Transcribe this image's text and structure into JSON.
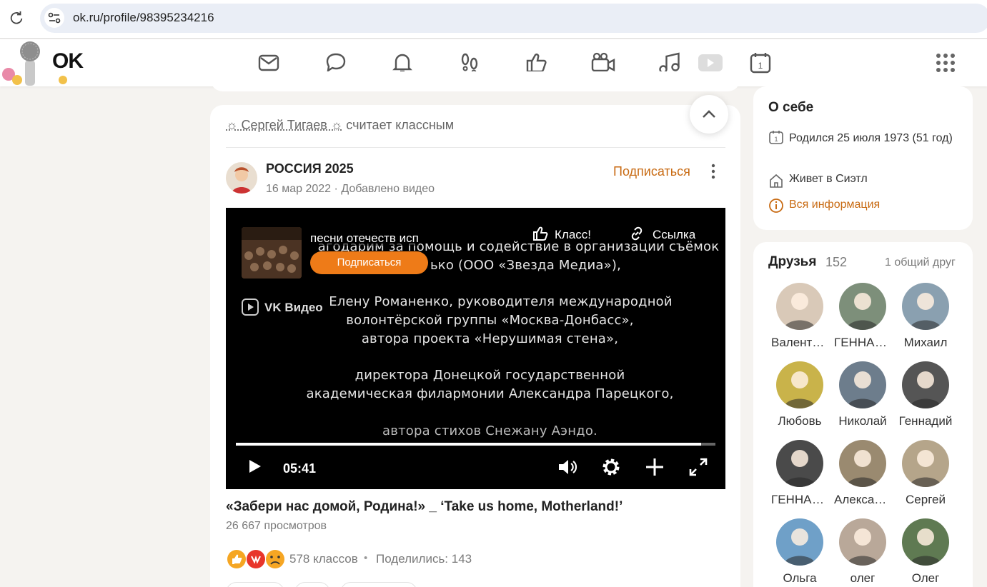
{
  "browser": {
    "url": "ok.ru/profile/98395234216"
  },
  "header": {
    "logo_text": "OK",
    "nav": [
      "messages-icon",
      "discussions-icon",
      "notifications-icon",
      "guests-icon",
      "events-icon",
      "video-icon",
      "music-icon",
      "vk-video-icon",
      "calendar-icon",
      "apps-grid-icon"
    ]
  },
  "feed": {
    "liked": {
      "user": "☼ Сергей Тигаев ☼",
      "action": "считает классным"
    },
    "post": {
      "author": "РОССИЯ 2025",
      "date": "16 мар 2022",
      "sep": "·",
      "action": "Добавлено видео",
      "subscribe": "Подписаться",
      "video": {
        "channel_title": "песни отечеств исп",
        "subscribe": "Подписаться",
        "klass": "Класс!",
        "link": "Ссылка",
        "brand": "VK Видео",
        "time": "05:41",
        "progress": 0.97,
        "credits": [
          "агодарим за помощь и содействие в организации съёмок",
          "ько (ООО «Звезда Медиа»),",
          "Елену Романенко, руководителя международной",
          "волонтёрской группы «Москва-Донбасс»,",
          "автора проекта «Нерушимая стена»,",
          "директора Донецкой государственной",
          "академическая филармонии Александра Парецкого,",
          "автора стихов Снежану Аэндо."
        ]
      },
      "title": "«Забери нас домой, Родина!» _ ‘Take us home, Motherland!’",
      "views": "26 667 просмотров",
      "klass_count": "578 классов",
      "dot": "•",
      "shares": "Поделились: 143"
    }
  },
  "about": {
    "title": "О себе",
    "born": "Родился 25 июля 1973 (51 год)",
    "lives": "Живет в Сиэтл",
    "all_info": "Вся информация"
  },
  "friends": {
    "title": "Друзья",
    "count": "152",
    "mutual": "1 общий друг",
    "list": [
      {
        "name": "Валентина",
        "color": "#d9c9b8"
      },
      {
        "name": "ГЕННАДИЙ",
        "color": "#7d8f7a"
      },
      {
        "name": "Михаил",
        "color": "#8aa0b0"
      },
      {
        "name": "Любовь",
        "color": "#c9b34a"
      },
      {
        "name": "Николай",
        "color": "#6d7d8c"
      },
      {
        "name": "Геннадий",
        "color": "#555555"
      },
      {
        "name": "ГЕННАДИЙ",
        "color": "#4a4a4a"
      },
      {
        "name": "Александр",
        "color": "#9a8a70"
      },
      {
        "name": "Сергей",
        "color": "#b5a58a"
      },
      {
        "name": "Ольга",
        "color": "#6fa0c8"
      },
      {
        "name": "олег",
        "color": "#b9a899"
      },
      {
        "name": "Олег",
        "color": "#5f7a52"
      }
    ]
  }
}
